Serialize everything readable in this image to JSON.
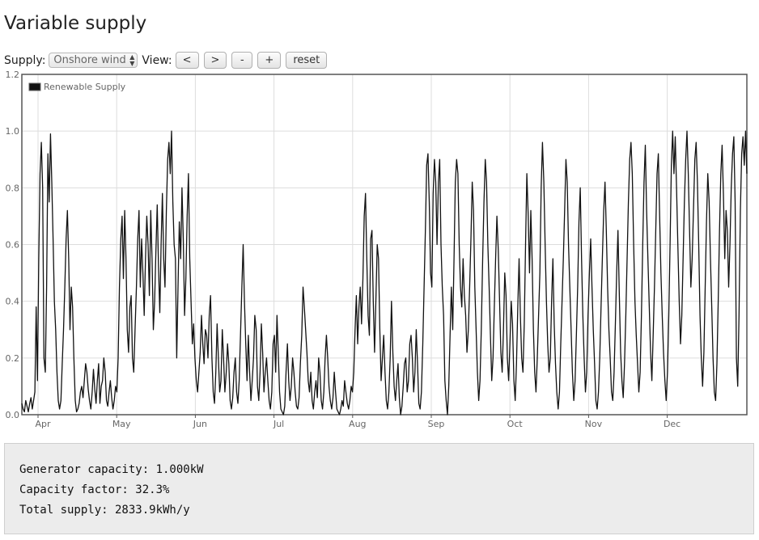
{
  "page": {
    "title": "Variable supply"
  },
  "controls": {
    "supply_label": "Supply:",
    "supply_value": "Onshore wind",
    "view_label": "View:",
    "buttons": [
      "<",
      ">",
      "-",
      "+",
      "reset"
    ]
  },
  "chart_data": {
    "type": "line",
    "legend": "Renewable Supply",
    "legend_position": "top-left",
    "ylim": [
      0,
      1.2
    ],
    "y_ticks": [
      "0.0",
      "0.2",
      "0.4",
      "0.6",
      "0.8",
      "1.0",
      "1.2"
    ],
    "x_ticks": [
      "Apr",
      "May",
      "Jun",
      "Jul",
      "Aug",
      "Sep",
      "Oct",
      "Nov",
      "Dec"
    ],
    "grid": true,
    "series": [
      {
        "name": "Renewable Supply",
        "x_unit": "day",
        "x_start": 0,
        "x_step": 0.7,
        "values": [
          0.04,
          0.02,
          0.01,
          0.05,
          0.03,
          0.01,
          0.04,
          0.06,
          0.02,
          0.05,
          0.08,
          0.38,
          0.12,
          0.55,
          0.85,
          0.96,
          0.8,
          0.2,
          0.15,
          0.45,
          0.92,
          0.75,
          0.99,
          0.82,
          0.62,
          0.4,
          0.3,
          0.15,
          0.05,
          0.02,
          0.05,
          0.18,
          0.3,
          0.45,
          0.62,
          0.72,
          0.55,
          0.3,
          0.45,
          0.38,
          0.2,
          0.05,
          0.01,
          0.02,
          0.04,
          0.08,
          0.1,
          0.06,
          0.12,
          0.18,
          0.15,
          0.09,
          0.05,
          0.02,
          0.08,
          0.16,
          0.09,
          0.04,
          0.12,
          0.18,
          0.04,
          0.1,
          0.12,
          0.2,
          0.15,
          0.05,
          0.03,
          0.08,
          0.12,
          0.06,
          0.02,
          0.05,
          0.1,
          0.08,
          0.2,
          0.45,
          0.62,
          0.7,
          0.48,
          0.72,
          0.55,
          0.3,
          0.22,
          0.38,
          0.42,
          0.2,
          0.15,
          0.3,
          0.45,
          0.62,
          0.72,
          0.45,
          0.62,
          0.5,
          0.35,
          0.55,
          0.7,
          0.6,
          0.42,
          0.72,
          0.55,
          0.3,
          0.4,
          0.58,
          0.74,
          0.52,
          0.36,
          0.6,
          0.78,
          0.55,
          0.45,
          0.72,
          0.9,
          0.96,
          0.85,
          1.0,
          0.75,
          0.6,
          0.55,
          0.2,
          0.45,
          0.68,
          0.55,
          0.8,
          0.62,
          0.35,
          0.48,
          0.7,
          0.85,
          0.55,
          0.4,
          0.25,
          0.32,
          0.2,
          0.12,
          0.08,
          0.15,
          0.22,
          0.35,
          0.25,
          0.18,
          0.3,
          0.28,
          0.2,
          0.35,
          0.42,
          0.2,
          0.08,
          0.04,
          0.15,
          0.32,
          0.2,
          0.08,
          0.12,
          0.3,
          0.2,
          0.08,
          0.15,
          0.25,
          0.18,
          0.05,
          0.02,
          0.06,
          0.15,
          0.2,
          0.08,
          0.04,
          0.12,
          0.28,
          0.45,
          0.6,
          0.4,
          0.25,
          0.12,
          0.28,
          0.15,
          0.05,
          0.12,
          0.2,
          0.35,
          0.3,
          0.1,
          0.05,
          0.15,
          0.32,
          0.22,
          0.08,
          0.15,
          0.2,
          0.12,
          0.05,
          0.02,
          0.08,
          0.25,
          0.28,
          0.15,
          0.35,
          0.22,
          0.08,
          0.02,
          0.01,
          0.0,
          0.03,
          0.15,
          0.25,
          0.12,
          0.05,
          0.1,
          0.2,
          0.15,
          0.08,
          0.03,
          0.02,
          0.06,
          0.18,
          0.28,
          0.45,
          0.38,
          0.3,
          0.22,
          0.12,
          0.08,
          0.15,
          0.05,
          0.02,
          0.08,
          0.12,
          0.06,
          0.2,
          0.15,
          0.05,
          0.02,
          0.08,
          0.2,
          0.28,
          0.2,
          0.1,
          0.05,
          0.02,
          0.06,
          0.15,
          0.08,
          0.02,
          0.01,
          0.0,
          0.02,
          0.05,
          0.03,
          0.12,
          0.08,
          0.04,
          0.02,
          0.05,
          0.1,
          0.08,
          0.15,
          0.3,
          0.42,
          0.25,
          0.38,
          0.45,
          0.32,
          0.48,
          0.7,
          0.78,
          0.55,
          0.35,
          0.28,
          0.62,
          0.65,
          0.4,
          0.22,
          0.4,
          0.6,
          0.55,
          0.3,
          0.12,
          0.2,
          0.28,
          0.15,
          0.05,
          0.02,
          0.08,
          0.2,
          0.4,
          0.22,
          0.1,
          0.05,
          0.12,
          0.18,
          0.06,
          0.0,
          0.03,
          0.1,
          0.18,
          0.2,
          0.08,
          0.12,
          0.25,
          0.28,
          0.2,
          0.08,
          0.15,
          0.3,
          0.18,
          0.04,
          0.02,
          0.08,
          0.25,
          0.45,
          0.65,
          0.88,
          0.92,
          0.75,
          0.5,
          0.45,
          0.78,
          0.9,
          0.82,
          0.6,
          0.82,
          0.9,
          0.6,
          0.45,
          0.35,
          0.12,
          0.05,
          0.0,
          0.1,
          0.28,
          0.45,
          0.3,
          0.55,
          0.82,
          0.9,
          0.85,
          0.6,
          0.45,
          0.38,
          0.55,
          0.42,
          0.35,
          0.22,
          0.3,
          0.45,
          0.62,
          0.82,
          0.72,
          0.45,
          0.3,
          0.15,
          0.05,
          0.12,
          0.3,
          0.55,
          0.75,
          0.9,
          0.82,
          0.6,
          0.45,
          0.28,
          0.12,
          0.2,
          0.38,
          0.55,
          0.7,
          0.58,
          0.4,
          0.22,
          0.15,
          0.3,
          0.5,
          0.42,
          0.2,
          0.12,
          0.25,
          0.4,
          0.32,
          0.12,
          0.05,
          0.18,
          0.38,
          0.55,
          0.35,
          0.2,
          0.15,
          0.32,
          0.6,
          0.85,
          0.7,
          0.5,
          0.72,
          0.55,
          0.3,
          0.15,
          0.08,
          0.2,
          0.35,
          0.5,
          0.8,
          0.96,
          0.82,
          0.6,
          0.4,
          0.25,
          0.15,
          0.2,
          0.4,
          0.55,
          0.32,
          0.18,
          0.08,
          0.02,
          0.08,
          0.25,
          0.4,
          0.55,
          0.72,
          0.9,
          0.82,
          0.6,
          0.45,
          0.3,
          0.15,
          0.05,
          0.12,
          0.28,
          0.45,
          0.68,
          0.8,
          0.55,
          0.35,
          0.2,
          0.08,
          0.15,
          0.35,
          0.5,
          0.62,
          0.45,
          0.3,
          0.18,
          0.05,
          0.02,
          0.08,
          0.2,
          0.38,
          0.55,
          0.72,
          0.82,
          0.65,
          0.45,
          0.3,
          0.2,
          0.08,
          0.05,
          0.15,
          0.32,
          0.5,
          0.65,
          0.42,
          0.22,
          0.12,
          0.06,
          0.18,
          0.35,
          0.55,
          0.75,
          0.9,
          0.96,
          0.85,
          0.6,
          0.4,
          0.28,
          0.18,
          0.08,
          0.15,
          0.35,
          0.6,
          0.82,
          0.95,
          0.72,
          0.55,
          0.38,
          0.22,
          0.12,
          0.28,
          0.45,
          0.65,
          0.85,
          0.92,
          0.7,
          0.5,
          0.35,
          0.22,
          0.12,
          0.05,
          0.15,
          0.35,
          0.6,
          0.88,
          1.0,
          0.85,
          0.98,
          0.8,
          0.6,
          0.4,
          0.25,
          0.35,
          0.55,
          0.75,
          0.9,
          1.0,
          0.85,
          0.65,
          0.45,
          0.55,
          0.72,
          0.9,
          0.96,
          0.82,
          0.6,
          0.35,
          0.2,
          0.1,
          0.22,
          0.45,
          0.68,
          0.85,
          0.75,
          0.55,
          0.38,
          0.2,
          0.08,
          0.05,
          0.18,
          0.4,
          0.65,
          0.85,
          0.95,
          0.78,
          0.55,
          0.72,
          0.65,
          0.45,
          0.6,
          0.8,
          0.92,
          0.98,
          0.75,
          0.2,
          0.1,
          0.35,
          0.72,
          0.92,
          0.98,
          0.88,
          1.0,
          0.85
        ]
      }
    ]
  },
  "stats": {
    "capacity": "Generator capacity: 1.000kW",
    "capacity_factor": "Capacity factor: 32.3%",
    "total_supply": "Total supply: 2833.9kWh/y"
  },
  "colors": {
    "line": "#111111",
    "grid": "#dddddd",
    "border": "#555555",
    "axis_text": "#666666"
  }
}
